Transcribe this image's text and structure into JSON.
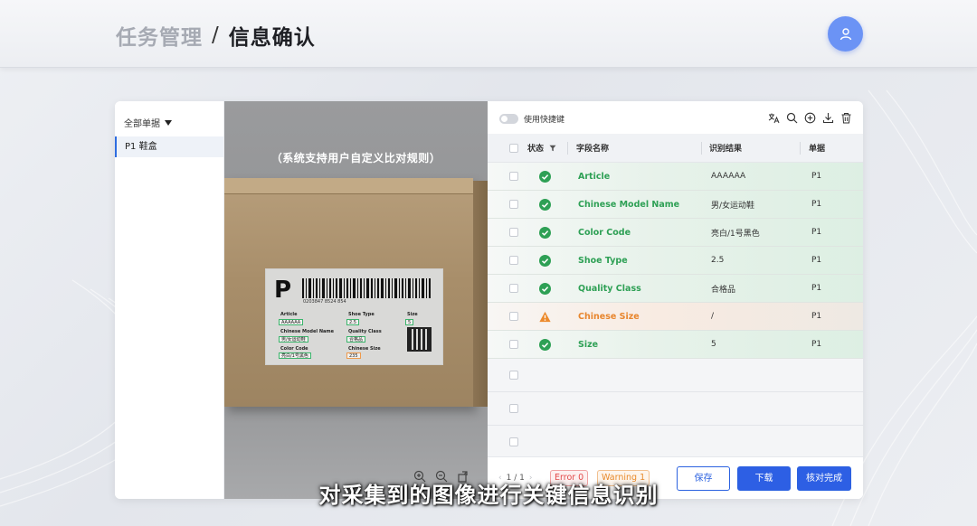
{
  "header": {
    "breadcrumb_parent": "任务管理",
    "breadcrumb_separator": "/",
    "breadcrumb_current": "信息确认",
    "avatar_icon": "user-icon"
  },
  "sidebar": {
    "filter_label": "全部单据",
    "items": [
      {
        "label": "P1 鞋盒"
      }
    ]
  },
  "viewer": {
    "rule_note": "（系统支持用户自定义比对规则）",
    "label": {
      "big_letter": "P",
      "barcode_number": "0203847  8524 854",
      "fields": {
        "article": {
          "name": "Article",
          "value": "AAAAAA"
        },
        "model": {
          "name": "Chinese Model Name",
          "value": "男/女运动鞋"
        },
        "color": {
          "name": "Color Code",
          "value": "亮白/1号黑色"
        },
        "shoe_type": {
          "name": "Shoe Type",
          "value": "2.5"
        },
        "quality": {
          "name": "Quality Class",
          "value": "合格品"
        },
        "csize": {
          "name": "Chinese Size",
          "value": "235"
        },
        "size": {
          "name": "Size",
          "value": "5"
        }
      }
    },
    "tools": [
      "zoom-in-icon",
      "zoom-out-icon",
      "rotate-icon"
    ]
  },
  "panel": {
    "quick_key_label": "使用快捷键",
    "toolbar_icons": [
      "translate-icon",
      "search-icon",
      "add-icon",
      "download-icon",
      "trash-icon"
    ],
    "columns": {
      "status": "状态",
      "field": "字段名称",
      "result": "识别结果",
      "doc": "单据"
    },
    "rows": [
      {
        "status": "ok",
        "field": "Article",
        "result": "AAAAAA",
        "doc": "P1"
      },
      {
        "status": "ok",
        "field": "Chinese Model Name",
        "result": "男/女运动鞋",
        "doc": "P1"
      },
      {
        "status": "ok",
        "field": "Color Code",
        "result": "亮白/1号黑色",
        "doc": "P1"
      },
      {
        "status": "ok",
        "field": "Shoe Type",
        "result": "2.5",
        "doc": "P1"
      },
      {
        "status": "ok",
        "field": "Quality Class",
        "result": "合格品",
        "doc": "P1"
      },
      {
        "status": "warn",
        "field": "Chinese Size",
        "result": "/",
        "doc": "P1"
      },
      {
        "status": "ok",
        "field": "Size",
        "result": "5",
        "doc": "P1"
      }
    ],
    "empty_rows": 3,
    "footer": {
      "pager": "1 / 1",
      "error_tag": "Error 0",
      "warning_tag": "Warning 1",
      "save_button": "保存",
      "download_button": "下载",
      "verify_button": "核对完成"
    }
  },
  "subtitle": "对采集到的图像进行关键信息识别",
  "colors": {
    "accent": "#2d5fe4",
    "ok": "#2ea055",
    "warn": "#e8862e",
    "error": "#e24a4a"
  }
}
